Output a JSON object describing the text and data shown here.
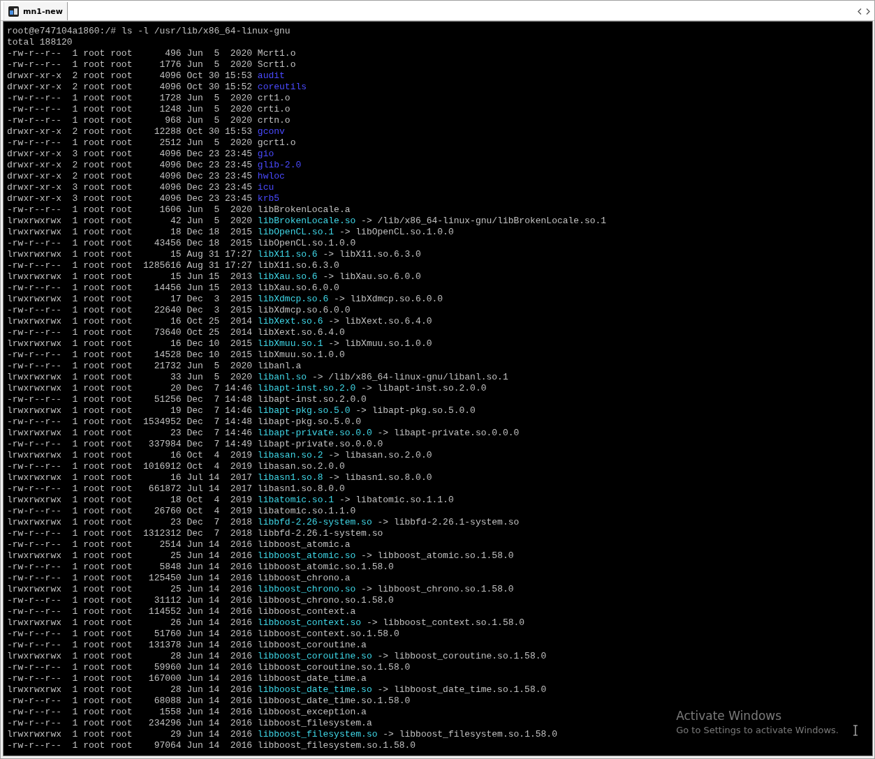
{
  "tab": {
    "title": "mn1-new"
  },
  "terminal": {
    "prompt": "root@e747104a1860:/# ls -l /usr/lib/x86_64-linux-gnu",
    "total": "total 188120",
    "entries": [
      {
        "kind": "file",
        "info": "-rw-r--r--  1 root root      496 Jun  5  2020",
        "name": "Mcrt1.o"
      },
      {
        "kind": "file",
        "info": "-rw-r--r--  1 root root     1776 Jun  5  2020",
        "name": "Scrt1.o"
      },
      {
        "kind": "dir",
        "info": "drwxr-xr-x  2 root root     4096 Oct 30 15:53",
        "name": "audit"
      },
      {
        "kind": "dir",
        "info": "drwxr-xr-x  2 root root     4096 Oct 30 15:52",
        "name": "coreutils"
      },
      {
        "kind": "file",
        "info": "-rw-r--r--  1 root root     1728 Jun  5  2020",
        "name": "crt1.o"
      },
      {
        "kind": "file",
        "info": "-rw-r--r--  1 root root     1248 Jun  5  2020",
        "name": "crti.o"
      },
      {
        "kind": "file",
        "info": "-rw-r--r--  1 root root      968 Jun  5  2020",
        "name": "crtn.o"
      },
      {
        "kind": "dir",
        "info": "drwxr-xr-x  2 root root    12288 Oct 30 15:53",
        "name": "gconv"
      },
      {
        "kind": "file",
        "info": "-rw-r--r--  1 root root     2512 Jun  5  2020",
        "name": "gcrt1.o"
      },
      {
        "kind": "dir",
        "info": "drwxr-xr-x  3 root root     4096 Dec 23 23:45",
        "name": "gio"
      },
      {
        "kind": "dir",
        "info": "drwxr-xr-x  2 root root     4096 Dec 23 23:45",
        "name": "glib-2.0"
      },
      {
        "kind": "dir",
        "info": "drwxr-xr-x  2 root root     4096 Dec 23 23:45",
        "name": "hwloc"
      },
      {
        "kind": "dir",
        "info": "drwxr-xr-x  3 root root     4096 Dec 23 23:45",
        "name": "icu"
      },
      {
        "kind": "dir",
        "info": "drwxr-xr-x  3 root root     4096 Dec 23 23:45",
        "name": "krb5"
      },
      {
        "kind": "file",
        "info": "-rw-r--r--  1 root root     1606 Jun  5  2020",
        "name": "libBrokenLocale.a"
      },
      {
        "kind": "link",
        "info": "lrwxrwxrwx  1 root root       42 Jun  5  2020",
        "name": "libBrokenLocale.so",
        "target": "-> /lib/x86_64-linux-gnu/libBrokenLocale.so.1"
      },
      {
        "kind": "link",
        "info": "lrwxrwxrwx  1 root root       18 Dec 18  2015",
        "name": "libOpenCL.so.1",
        "target": "-> libOpenCL.so.1.0.0"
      },
      {
        "kind": "file",
        "info": "-rw-r--r--  1 root root    43456 Dec 18  2015",
        "name": "libOpenCL.so.1.0.0"
      },
      {
        "kind": "link",
        "info": "lrwxrwxrwx  1 root root       15 Aug 31 17:27",
        "name": "libX11.so.6",
        "target": "-> libX11.so.6.3.0"
      },
      {
        "kind": "file",
        "info": "-rw-r--r--  1 root root  1285616 Aug 31 17:27",
        "name": "libX11.so.6.3.0"
      },
      {
        "kind": "link",
        "info": "lrwxrwxrwx  1 root root       15 Jun 15  2013",
        "name": "libXau.so.6",
        "target": "-> libXau.so.6.0.0"
      },
      {
        "kind": "file",
        "info": "-rw-r--r--  1 root root    14456 Jun 15  2013",
        "name": "libXau.so.6.0.0"
      },
      {
        "kind": "link",
        "info": "lrwxrwxrwx  1 root root       17 Dec  3  2015",
        "name": "libXdmcp.so.6",
        "target": "-> libXdmcp.so.6.0.0"
      },
      {
        "kind": "file",
        "info": "-rw-r--r--  1 root root    22640 Dec  3  2015",
        "name": "libXdmcp.so.6.0.0"
      },
      {
        "kind": "link",
        "info": "lrwxrwxrwx  1 root root       16 Oct 25  2014",
        "name": "libXext.so.6",
        "target": "-> libXext.so.6.4.0"
      },
      {
        "kind": "file",
        "info": "-rw-r--r--  1 root root    73640 Oct 25  2014",
        "name": "libXext.so.6.4.0"
      },
      {
        "kind": "link",
        "info": "lrwxrwxrwx  1 root root       16 Dec 10  2015",
        "name": "libXmuu.so.1",
        "target": "-> libXmuu.so.1.0.0"
      },
      {
        "kind": "file",
        "info": "-rw-r--r--  1 root root    14528 Dec 10  2015",
        "name": "libXmuu.so.1.0.0"
      },
      {
        "kind": "file",
        "info": "-rw-r--r--  1 root root    21732 Jun  5  2020",
        "name": "libanl.a"
      },
      {
        "kind": "link",
        "info": "lrwxrwxrwx  1 root root       33 Jun  5  2020",
        "name": "libanl.so",
        "target": "-> /lib/x86_64-linux-gnu/libanl.so.1"
      },
      {
        "kind": "link",
        "info": "lrwxrwxrwx  1 root root       20 Dec  7 14:46",
        "name": "libapt-inst.so.2.0",
        "target": "-> libapt-inst.so.2.0.0"
      },
      {
        "kind": "file",
        "info": "-rw-r--r--  1 root root    51256 Dec  7 14:48",
        "name": "libapt-inst.so.2.0.0"
      },
      {
        "kind": "link",
        "info": "lrwxrwxrwx  1 root root       19 Dec  7 14:46",
        "name": "libapt-pkg.so.5.0",
        "target": "-> libapt-pkg.so.5.0.0"
      },
      {
        "kind": "file",
        "info": "-rw-r--r--  1 root root  1534952 Dec  7 14:48",
        "name": "libapt-pkg.so.5.0.0"
      },
      {
        "kind": "link",
        "info": "lrwxrwxrwx  1 root root       23 Dec  7 14:46",
        "name": "libapt-private.so.0.0",
        "target": "-> libapt-private.so.0.0.0"
      },
      {
        "kind": "file",
        "info": "-rw-r--r--  1 root root   337984 Dec  7 14:49",
        "name": "libapt-private.so.0.0.0"
      },
      {
        "kind": "link",
        "info": "lrwxrwxrwx  1 root root       16 Oct  4  2019",
        "name": "libasan.so.2",
        "target": "-> libasan.so.2.0.0"
      },
      {
        "kind": "file",
        "info": "-rw-r--r--  1 root root  1016912 Oct  4  2019",
        "name": "libasan.so.2.0.0"
      },
      {
        "kind": "link",
        "info": "lrwxrwxrwx  1 root root       16 Jul 14  2017",
        "name": "libasn1.so.8",
        "target": "-> libasn1.so.8.0.0"
      },
      {
        "kind": "file",
        "info": "-rw-r--r--  1 root root   661872 Jul 14  2017",
        "name": "libasn1.so.8.0.0"
      },
      {
        "kind": "link",
        "info": "lrwxrwxrwx  1 root root       18 Oct  4  2019",
        "name": "libatomic.so.1",
        "target": "-> libatomic.so.1.1.0"
      },
      {
        "kind": "file",
        "info": "-rw-r--r--  1 root root    26760 Oct  4  2019",
        "name": "libatomic.so.1.1.0"
      },
      {
        "kind": "link",
        "info": "lrwxrwxrwx  1 root root       23 Dec  7  2018",
        "name": "libbfd-2.26-system.so",
        "target": "-> libbfd-2.26.1-system.so"
      },
      {
        "kind": "file",
        "info": "-rw-r--r--  1 root root  1312312 Dec  7  2018",
        "name": "libbfd-2.26.1-system.so"
      },
      {
        "kind": "file",
        "info": "-rw-r--r--  1 root root     2514 Jun 14  2016",
        "name": "libboost_atomic.a"
      },
      {
        "kind": "link",
        "info": "lrwxrwxrwx  1 root root       25 Jun 14  2016",
        "name": "libboost_atomic.so",
        "target": "-> libboost_atomic.so.1.58.0"
      },
      {
        "kind": "file",
        "info": "-rw-r--r--  1 root root     5848 Jun 14  2016",
        "name": "libboost_atomic.so.1.58.0"
      },
      {
        "kind": "file",
        "info": "-rw-r--r--  1 root root   125450 Jun 14  2016",
        "name": "libboost_chrono.a"
      },
      {
        "kind": "link",
        "info": "lrwxrwxrwx  1 root root       25 Jun 14  2016",
        "name": "libboost_chrono.so",
        "target": "-> libboost_chrono.so.1.58.0"
      },
      {
        "kind": "file",
        "info": "-rw-r--r--  1 root root    31112 Jun 14  2016",
        "name": "libboost_chrono.so.1.58.0"
      },
      {
        "kind": "file",
        "info": "-rw-r--r--  1 root root   114552 Jun 14  2016",
        "name": "libboost_context.a"
      },
      {
        "kind": "link",
        "info": "lrwxrwxrwx  1 root root       26 Jun 14  2016",
        "name": "libboost_context.so",
        "target": "-> libboost_context.so.1.58.0"
      },
      {
        "kind": "file",
        "info": "-rw-r--r--  1 root root    51760 Jun 14  2016",
        "name": "libboost_context.so.1.58.0"
      },
      {
        "kind": "file",
        "info": "-rw-r--r--  1 root root   131378 Jun 14  2016",
        "name": "libboost_coroutine.a"
      },
      {
        "kind": "link",
        "info": "lrwxrwxrwx  1 root root       28 Jun 14  2016",
        "name": "libboost_coroutine.so",
        "target": "-> libboost_coroutine.so.1.58.0"
      },
      {
        "kind": "file",
        "info": "-rw-r--r--  1 root root    59960 Jun 14  2016",
        "name": "libboost_coroutine.so.1.58.0"
      },
      {
        "kind": "file",
        "info": "-rw-r--r--  1 root root   167000 Jun 14  2016",
        "name": "libboost_date_time.a"
      },
      {
        "kind": "link",
        "info": "lrwxrwxrwx  1 root root       28 Jun 14  2016",
        "name": "libboost_date_time.so",
        "target": "-> libboost_date_time.so.1.58.0"
      },
      {
        "kind": "file",
        "info": "-rw-r--r--  1 root root    68088 Jun 14  2016",
        "name": "libboost_date_time.so.1.58.0"
      },
      {
        "kind": "file",
        "info": "-rw-r--r--  1 root root     1558 Jun 14  2016",
        "name": "libboost_exception.a"
      },
      {
        "kind": "file",
        "info": "-rw-r--r--  1 root root   234296 Jun 14  2016",
        "name": "libboost_filesystem.a"
      },
      {
        "kind": "link",
        "info": "lrwxrwxrwx  1 root root       29 Jun 14  2016",
        "name": "libboost_filesystem.so",
        "target": "-> libboost_filesystem.so.1.58.0"
      },
      {
        "kind": "file",
        "info": "-rw-r--r--  1 root root    97064 Jun 14  2016",
        "name": "libboost_filesystem.so.1.58.0"
      }
    ]
  },
  "activation_notice": {
    "title": "Activate Windows",
    "message": "Go to Settings to activate Windows."
  }
}
